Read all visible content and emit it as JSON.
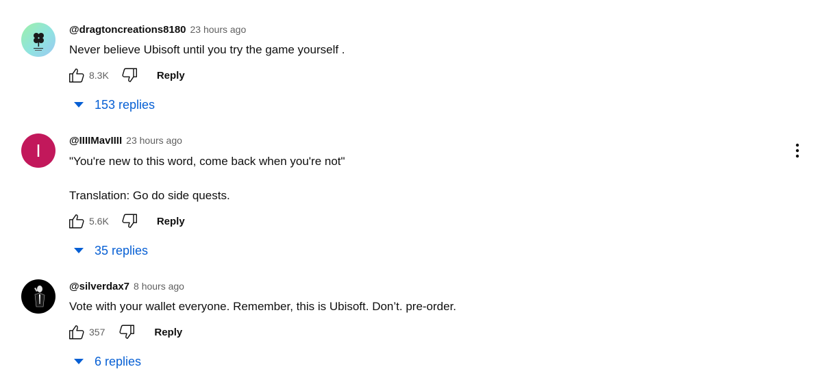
{
  "comments": [
    {
      "author": "@dragtoncreations8180",
      "time": "23 hours ago",
      "text_lines": [
        "Never believe Ubisoft until you try the game yourself ."
      ],
      "likes": "8.3K",
      "reply_label": "Reply",
      "replies_label": "153 replies",
      "avatar_icon": "clover-logo-icon"
    },
    {
      "author": "@IIIIMavIIII",
      "time": "23 hours ago",
      "text_lines": [
        "\"You're new to this word, come back when you're not\"",
        "Translation: Go do side quests."
      ],
      "likes": "5.6K",
      "reply_label": "Reply",
      "replies_label": "35 replies",
      "avatar_letter": "I",
      "avatar_color": "#c2185b"
    },
    {
      "author": "@silverdax7",
      "time": "8 hours ago",
      "text_lines": [
        "Vote with your wallet everyone. Remember, this is Ubisoft. Don’t. pre-order."
      ],
      "likes": "357",
      "reply_label": "Reply",
      "replies_label": "6 replies",
      "avatar_icon": "suited-figure-icon"
    }
  ],
  "colors": {
    "link_blue": "#065fd4",
    "secondary_text": "#606060",
    "primary_text": "#0f0f0f"
  }
}
